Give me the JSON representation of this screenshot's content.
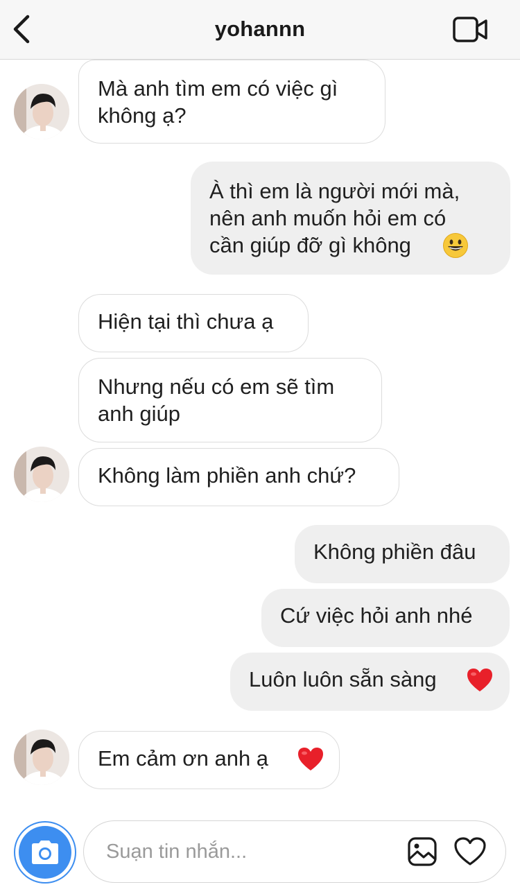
{
  "header": {
    "title": "yohannn",
    "back_icon": "chevron-left-icon",
    "video_icon": "video-call-icon"
  },
  "messages": [
    {
      "side": "in",
      "text": "Mà anh tìm em có việc gì\nkhông ạ?"
    },
    {
      "side": "out",
      "text": "À thì em là người mới mà,\nnên anh muốn hỏi em có\ncần giúp đỡ gì không",
      "emoji": "grinning-face"
    },
    {
      "side": "in",
      "text": "Hiện tại thì chưa ạ"
    },
    {
      "side": "in",
      "text": "Nhưng nếu có em sẽ tìm\nanh giúp"
    },
    {
      "side": "in",
      "text": "Không làm phiền anh chứ?"
    },
    {
      "side": "out",
      "text": "Không phiền đâu"
    },
    {
      "side": "out",
      "text": "Cứ việc hỏi anh nhé"
    },
    {
      "side": "out",
      "text": "Luôn luôn sẵn sàng",
      "emoji": "red-heart"
    },
    {
      "side": "in",
      "text": "Em cảm ơn anh ạ",
      "emoji": "red-heart"
    }
  ],
  "composer": {
    "placeholder": "Suạn tin nhắn...",
    "value": "",
    "camera_icon": "camera-icon",
    "gallery_icon": "gallery-icon",
    "heart_icon": "heart-outline-icon"
  },
  "colors": {
    "accent": "#3d8ef0",
    "incoming_bubble": "#ffffff",
    "outgoing_bubble": "#efefef",
    "header_bg": "#f7f7f7"
  }
}
